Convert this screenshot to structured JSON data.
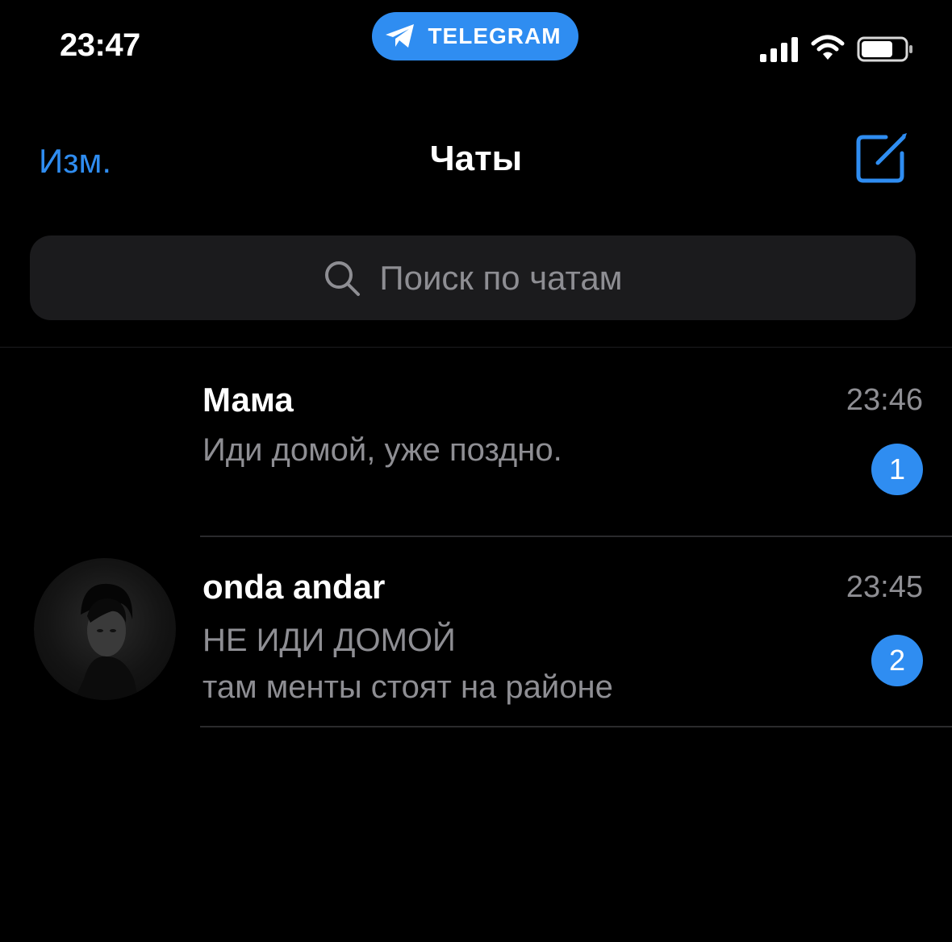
{
  "status_bar": {
    "time": "23:47",
    "app_pill": {
      "label": "TELEGRAM",
      "icon": "paper-plane-icon",
      "color": "#2f8df1"
    },
    "icons": [
      "cellular-signal-icon",
      "wifi-icon",
      "battery-icon"
    ]
  },
  "nav": {
    "edit_label": "Изм.",
    "title": "Чаты",
    "compose_icon": "compose-icon"
  },
  "search": {
    "placeholder": "Поиск по чатам",
    "icon": "search-icon"
  },
  "chats": [
    {
      "name": "Мама",
      "time": "23:46",
      "message_lines": [
        "Иди домой, уже поздно."
      ],
      "unread": "1",
      "has_avatar": false
    },
    {
      "name": "onda andar",
      "time": "23:45",
      "message_lines": [
        "НЕ ИДИ ДОМОЙ",
        "там менты стоят на районе"
      ],
      "unread": "2",
      "has_avatar": true
    }
  ],
  "colors": {
    "accent": "#2f8df1",
    "background": "#000000",
    "secondary_text": "#8e8e93",
    "search_bg": "#1b1b1d"
  }
}
